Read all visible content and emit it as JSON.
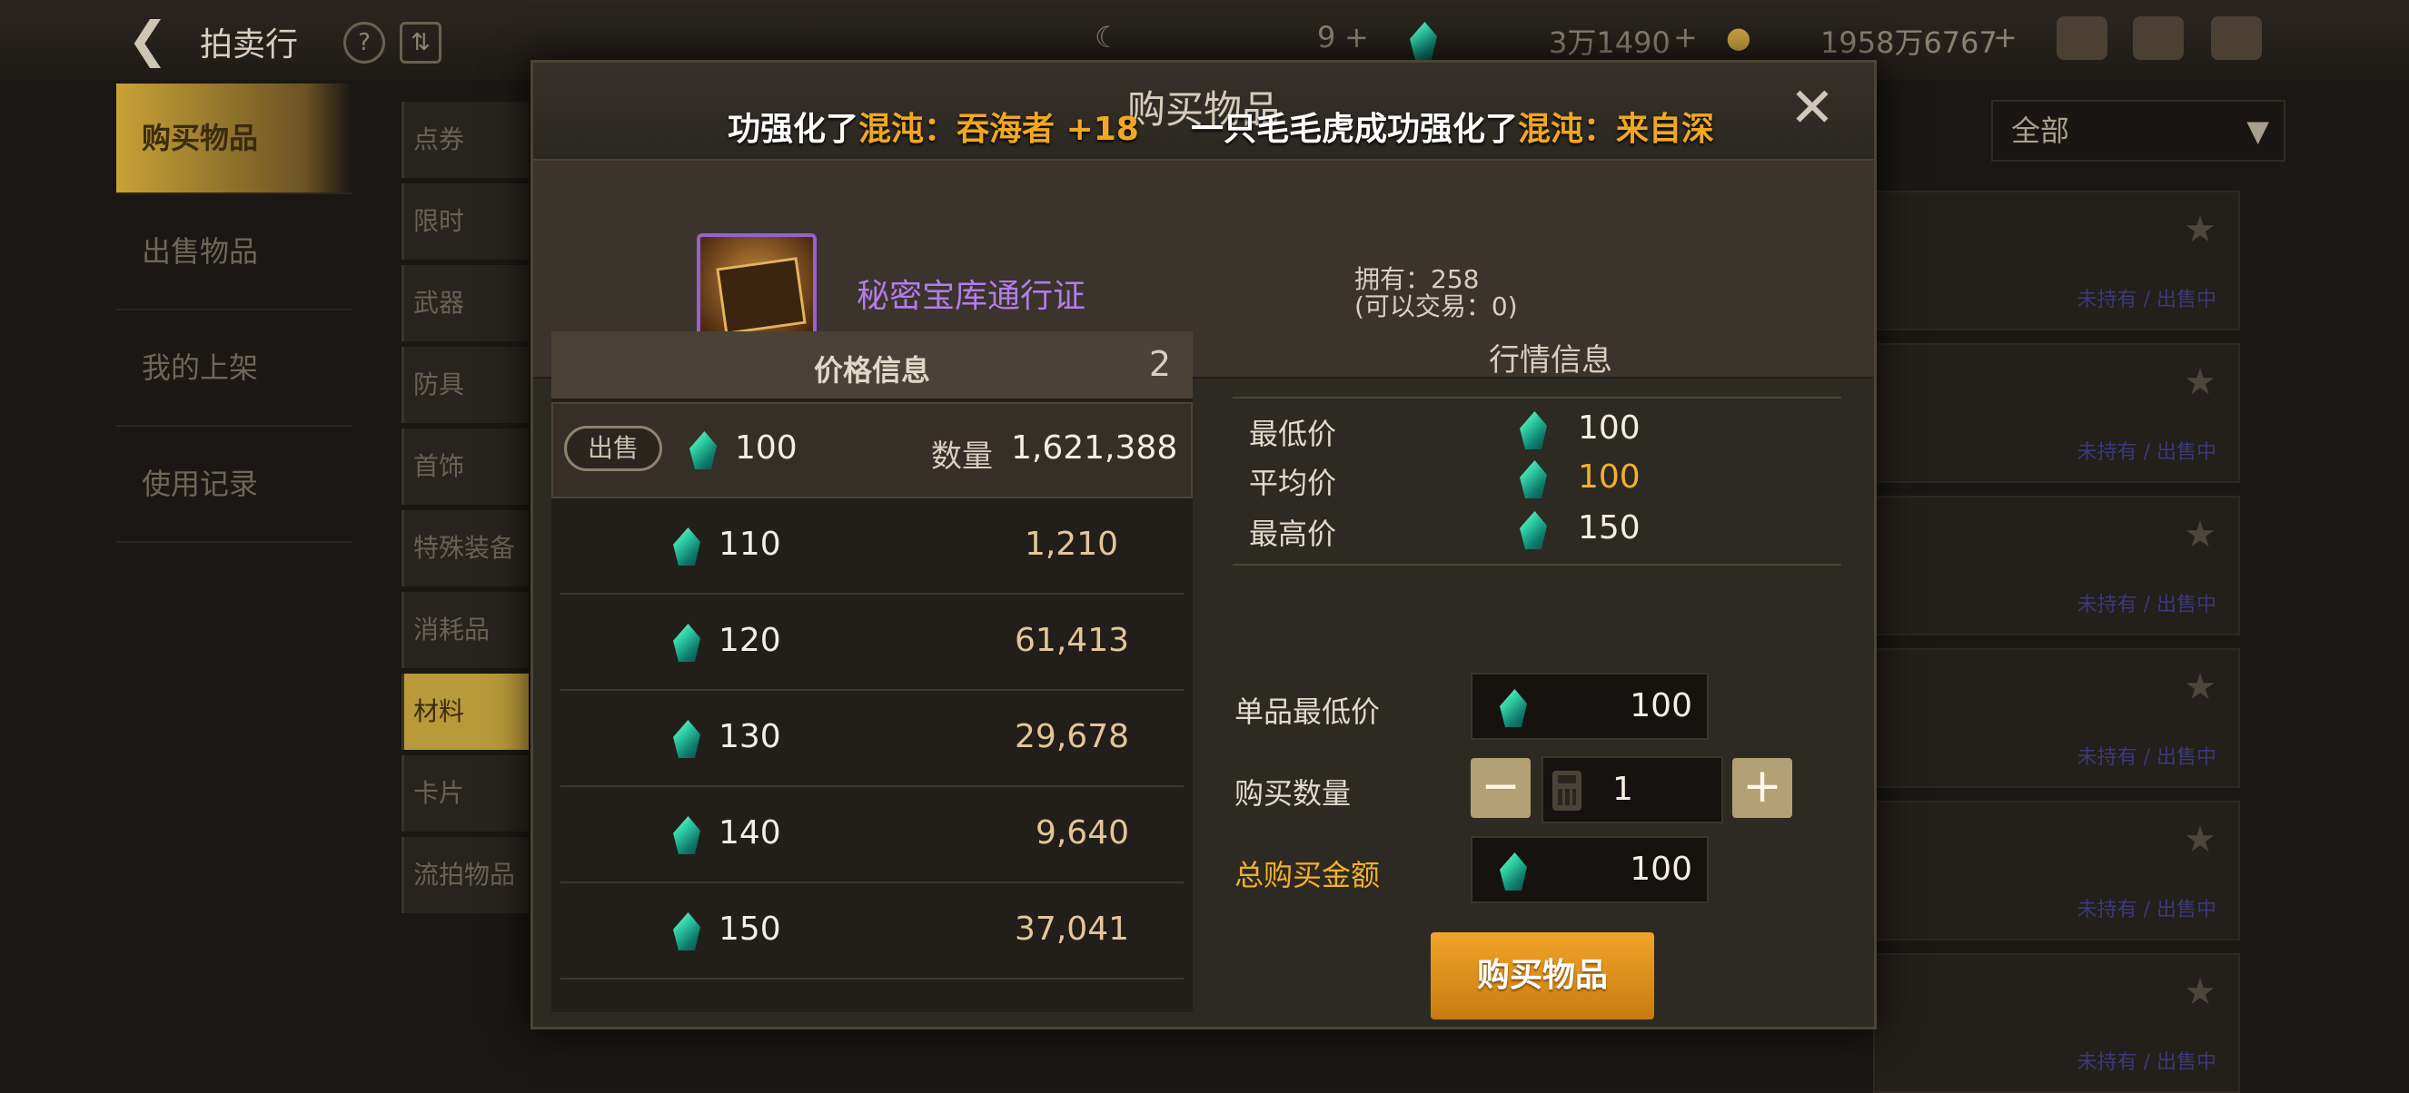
{
  "background": {
    "title": "拍卖行",
    "currency": [
      {
        "name": "moon-currency",
        "value": "9",
        "color": "#8a8170"
      },
      {
        "name": "gem-currency",
        "value": "3万1490",
        "color": "#2fd0a4"
      },
      {
        "name": "gold-currency",
        "value": "1958万6767",
        "color": "#e0b040"
      }
    ],
    "left_menu": [
      "购买物品",
      "出售物品",
      "我的上架",
      "使用记录"
    ],
    "categories": [
      "点券",
      "限时",
      "武器",
      "防具",
      "首饰",
      "特殊装备",
      "消耗品",
      "材料",
      "卡片",
      "流拍物品"
    ],
    "filter": "全部",
    "row_status": [
      "未持有",
      "出售中"
    ]
  },
  "modal": {
    "title": "购买物品",
    "ticker_left": {
      "pre": "功强化了",
      "hl1": "混沌：",
      "hl2": "吞海者 +18"
    },
    "ticker_right": {
      "pre": "一只毛毛虎成功强化了",
      "hl1": "混沌：",
      "hl2": "来自深"
    },
    "item": {
      "name": "秘密宝库通行证",
      "owned": "拥有：258",
      "tradable": "(可以交易：0)",
      "icon": "treasure-pass-icon"
    },
    "price_info": {
      "title": "价格信息",
      "count": "2",
      "sell_tag": "出售",
      "qty_label": "数量",
      "rows": [
        {
          "price": "100",
          "qty": "1,621,388"
        },
        {
          "price": "110",
          "qty": "1,210"
        },
        {
          "price": "120",
          "qty": "61,413"
        },
        {
          "price": "130",
          "qty": "29,678"
        },
        {
          "price": "140",
          "qty": "9,640"
        },
        {
          "price": "150",
          "qty": "37,041"
        }
      ]
    },
    "market_info": {
      "title": "行情信息",
      "min_label": "最低价",
      "min": "100",
      "avg_label": "平均价",
      "avg": "100",
      "max_label": "最高价",
      "max": "150"
    },
    "form": {
      "unit_min_label": "单品最低价",
      "unit_min": "100",
      "qty_label": "购买数量",
      "qty": "1",
      "total_label": "总购买金额",
      "total": "100",
      "buy_button": "购买物品"
    },
    "colors": {
      "accent": "#f2b02a",
      "item_name": "#b47ce8",
      "button": "#e0961f"
    }
  }
}
